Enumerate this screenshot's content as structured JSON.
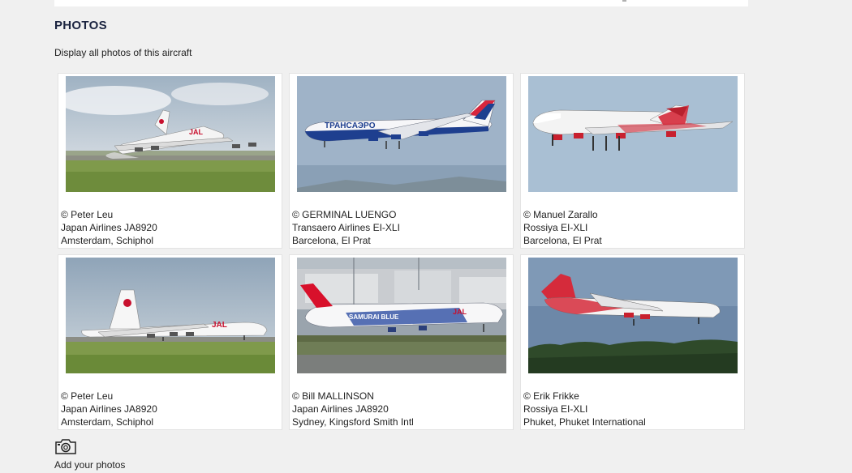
{
  "section": {
    "title": "PHOTOS",
    "display_all_link": "Display all photos of this aircraft"
  },
  "photos": [
    {
      "credit": "© Peter Leu",
      "aircraft": "Japan Airlines JA8920",
      "location": "Amsterdam, Schiphol",
      "scene": "jal-landing-grass"
    },
    {
      "credit": "© GERMINAL LUENGO",
      "aircraft": "Transaero Airlines EI-XLI",
      "location": "Barcelona, El Prat",
      "scene": "transaero-airborne"
    },
    {
      "credit": "© Manuel Zarallo",
      "aircraft": "Rossiya EI-XLI",
      "location": "Barcelona, El Prat",
      "scene": "rossiya-airborne"
    },
    {
      "credit": "© Peter Leu",
      "aircraft": "Japan Airlines JA8920",
      "location": "Amsterdam, Schiphol",
      "scene": "jal-taxi-grass"
    },
    {
      "credit": "© Bill MALLINSON",
      "aircraft": "Japan Airlines JA8920",
      "location": "Sydney, Kingsford Smith Intl",
      "scene": "jal-samurai-blue-ground"
    },
    {
      "credit": "© Erik Frikke",
      "aircraft": "Rossiya EI-XLI",
      "location": "Phuket, Phuket International",
      "scene": "rossiya-over-trees"
    }
  ],
  "add_photos": {
    "icon": "camera-icon",
    "label": "Add your photos"
  }
}
